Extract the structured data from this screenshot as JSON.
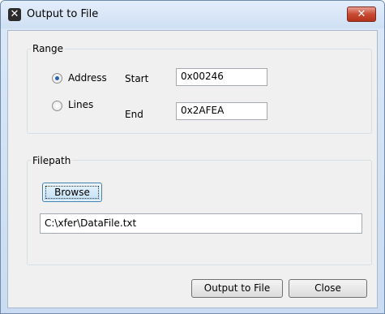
{
  "window": {
    "title": "Output to File",
    "close_glyph": "✕",
    "app_icon": "app-x-icon"
  },
  "range": {
    "group_label": "Range",
    "address_label": "Address",
    "lines_label": "Lines",
    "selected": "Address",
    "start_label": "Start",
    "start_value": "0x00246",
    "end_label": "End",
    "end_value": "0x2AFEA"
  },
  "filepath": {
    "group_label": "Filepath",
    "browse_label": "Browse",
    "path_value": "C:\\xfer\\DataFile.txt"
  },
  "actions": {
    "output_label": "Output to File",
    "close_label": "Close"
  },
  "colors": {
    "close_button": "#c94a33",
    "radio_dot": "#2a5eb3",
    "focused_button_border": "#3c7fb1"
  }
}
